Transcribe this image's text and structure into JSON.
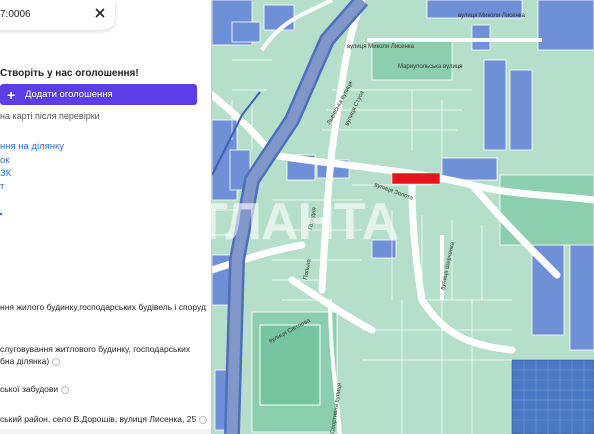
{
  "search": {
    "value": "7:0006"
  },
  "promo": {
    "title": "Створіть у нас оголошення!",
    "button_label": "Додати оголошення",
    "note": "на карті після перевірки"
  },
  "links": [
    "ння на ділянку",
    "ок",
    "ЗК",
    "т"
  ],
  "details": {
    "purpose": "ння жилого будинку,господарських будівель і споруд",
    "usage_line1": "слуговування житлового будинку, господарських",
    "usage_line2": "бна ділянка)",
    "development": "ської забудови",
    "address": "ський район, село В.Дорошів, вулиця Лисенка, 25"
  },
  "map": {
    "streets": {
      "lysenka": "вулиця Миколи Лисенка",
      "lysenka_short": "вулиця Миколи Лисенка",
      "svitlova": "вулиця Світлова",
      "sportyvna": "Спортивна вулиця",
      "horodna": "Городня",
      "pilna": "Польна",
      "shevchenka": "вулиця Шевченка",
      "lvivska": "Львівська вулиця",
      "stusa": "вулиця Стуса",
      "ploshcha": "Мариупольська вулиця",
      "zolota": "вулиця Золота"
    },
    "watermark": "АТЛАНТА",
    "highlight_color": "#e8141c"
  }
}
